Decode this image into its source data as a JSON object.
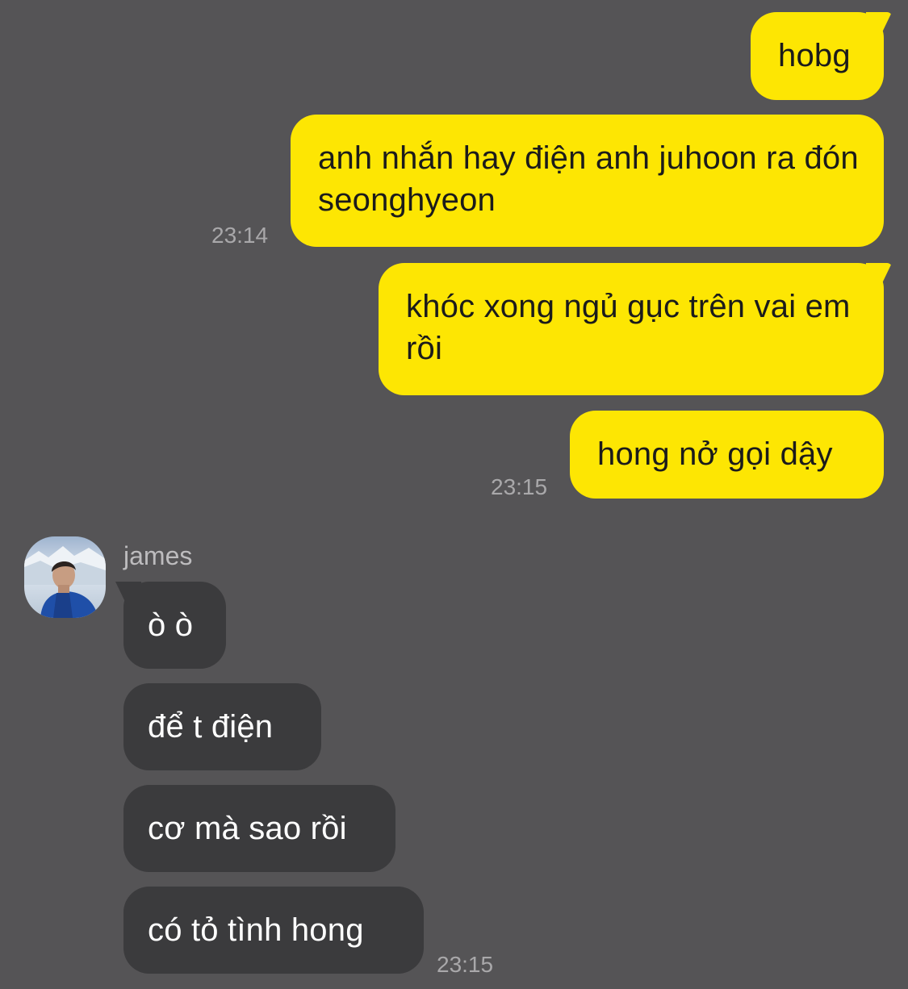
{
  "chat": {
    "sent_messages": [
      {
        "text": "hobg"
      },
      {
        "text": "anh nhắn hay điện anh juhoon ra đón seonghyeon"
      },
      {
        "text": "khóc xong ngủ gục trên vai em rồi"
      },
      {
        "text": "hong nở gọi dậy"
      }
    ],
    "sent_times": [
      "23:14",
      "23:15"
    ],
    "contact": {
      "name": "james",
      "avatar_icon": "profile-photo"
    },
    "received_messages": [
      {
        "text": "ò ò"
      },
      {
        "text": "để t điện"
      },
      {
        "text": "cơ mà sao rồi"
      },
      {
        "text": "có tỏ tình hong"
      }
    ],
    "received_time": "23:15"
  },
  "colors": {
    "background": "#555456",
    "sent_bubble": "#fde603",
    "received_bubble": "#3b3b3d",
    "timestamp": "#a9a8aa"
  }
}
